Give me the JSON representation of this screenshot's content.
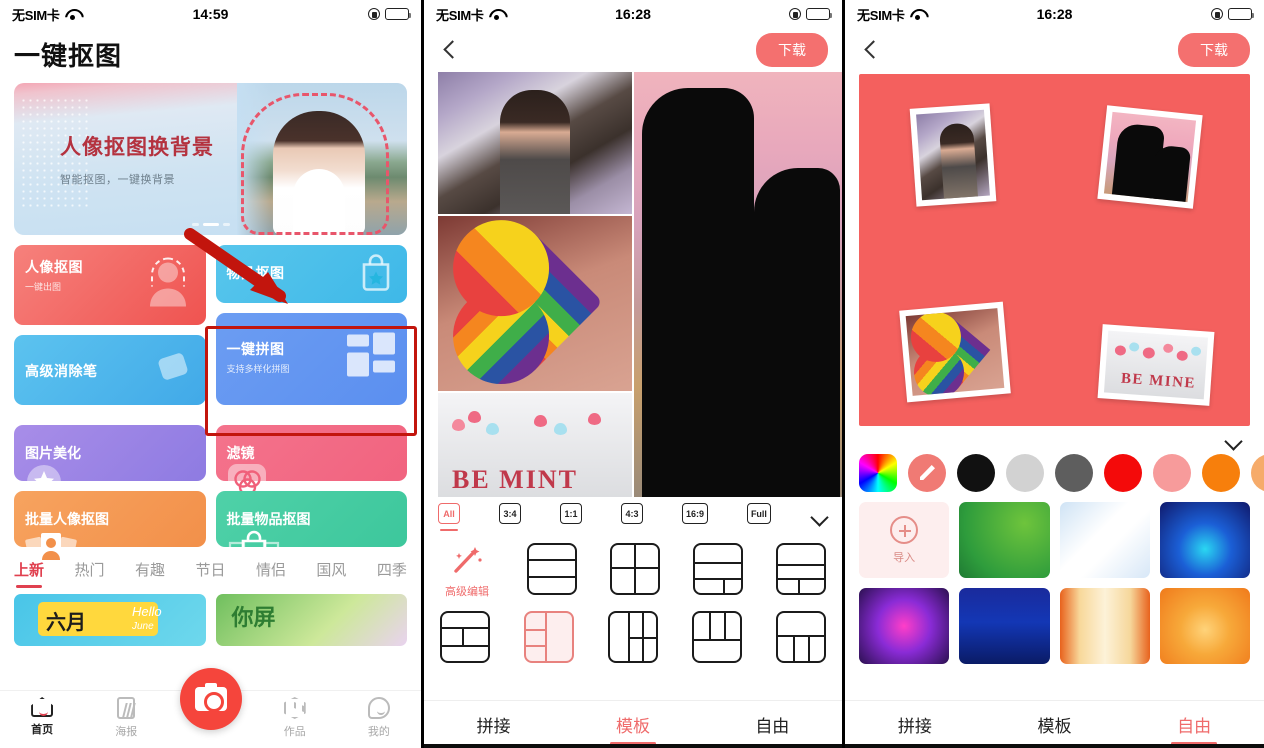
{
  "panel1": {
    "status": {
      "carrier": "无SIM卡",
      "time": "14:59",
      "wifi_icon": "wifi-icon",
      "lock_icon": "rotation-lock-icon",
      "battery_icon": "battery-icon"
    },
    "page_title": "一键抠图",
    "banner": {
      "title": "人像抠图换背景",
      "subtitle": "智能抠图，一键换背景"
    },
    "cards": [
      {
        "title": "人像抠图",
        "sub": "一键出图",
        "icon": "person-cutout-icon"
      },
      {
        "title": "物品抠图",
        "sub": "",
        "icon": "shopping-bag-star-icon"
      },
      {
        "title": "高级消除笔",
        "sub": "",
        "icon": "eraser-pen-icon"
      },
      {
        "title": "一键拼图",
        "sub": "支持多样化拼图",
        "icon": "collage-layout-icon"
      },
      {
        "title": "图片美化",
        "sub": "",
        "icon": "magic-star-icon"
      },
      {
        "title": "滤镜",
        "sub": "",
        "icon": "filter-circles-icon"
      },
      {
        "title": "批量人像抠图",
        "sub": "",
        "icon": "batch-person-icon"
      },
      {
        "title": "批量物品抠图",
        "sub": "",
        "icon": "batch-bag-icon"
      }
    ],
    "category_tabs": [
      {
        "label": "上新",
        "selected": true
      },
      {
        "label": "热门",
        "selected": false
      },
      {
        "label": "有趣",
        "selected": false
      },
      {
        "label": "节日",
        "selected": false
      },
      {
        "label": "情侣",
        "selected": false
      },
      {
        "label": "国风",
        "selected": false
      },
      {
        "label": "四季",
        "selected": false
      }
    ],
    "posters": [
      {
        "main": "六月",
        "hello": "Hello",
        "june": "June"
      },
      {
        "main": "你屏"
      }
    ],
    "camera_button_icon": "camera-icon",
    "tabbar": [
      {
        "label": "首页",
        "icon": "home-icon",
        "selected": true
      },
      {
        "label": "海报",
        "icon": "poster-icon",
        "selected": false
      },
      {
        "label": "作品",
        "icon": "works-icon",
        "selected": false
      },
      {
        "label": "我的",
        "icon": "profile-icon",
        "selected": false
      }
    ]
  },
  "panel2": {
    "status": {
      "carrier": "无SIM卡",
      "time": "16:28"
    },
    "nav": {
      "back_icon": "back-chevron-icon",
      "download_label": "下载"
    },
    "ratio_tabs": [
      {
        "label": "All",
        "selected": true
      },
      {
        "label": "3:4",
        "selected": false
      },
      {
        "label": "1:1",
        "selected": false
      },
      {
        "label": "4:3",
        "selected": false
      },
      {
        "label": "16:9",
        "selected": false
      },
      {
        "label": "Full",
        "selected": false
      }
    ],
    "expand_icon": "chevron-down-icon",
    "advanced_edit": {
      "label": "高级编辑",
      "icon": "magic-wand-icon"
    },
    "layout_selected_index": 6,
    "bottom_tabs": [
      {
        "label": "拼接",
        "selected": false
      },
      {
        "label": "模板",
        "selected": true
      },
      {
        "label": "自由",
        "selected": false
      }
    ],
    "bemine_text": "BE MINT"
  },
  "panel3": {
    "status": {
      "carrier": "无SIM卡",
      "time": "16:28"
    },
    "nav": {
      "back_icon": "back-chevron-icon",
      "download_label": "下载"
    },
    "canvas_background_color": "#f4605e",
    "bemine_text": "BE MINE",
    "collapse_icon": "chevron-down-icon",
    "color_swatches": [
      {
        "name": "rainbow-picker",
        "color": "rainbow"
      },
      {
        "name": "eyedropper",
        "color": "#f07a74"
      },
      {
        "name": "black",
        "color": "#111111"
      },
      {
        "name": "light-gray",
        "color": "#d2d2d2"
      },
      {
        "name": "dark-gray",
        "color": "#5e5e5e"
      },
      {
        "name": "red",
        "color": "#f40a0a"
      },
      {
        "name": "pink",
        "color": "#f79b9b"
      },
      {
        "name": "orange",
        "color": "#f77f0c"
      },
      {
        "name": "light-orange",
        "color": "#f6ab6a"
      }
    ],
    "import_tile": {
      "label": "导入",
      "icon": "plus-icon"
    },
    "backgrounds": [
      "green-gradient",
      "white-light-burst",
      "blue-tunnel",
      "purple-cube",
      "blue-city",
      "gold-light",
      "orange-hexagon"
    ],
    "bottom_tabs": [
      {
        "label": "拼接",
        "selected": false
      },
      {
        "label": "模板",
        "selected": false
      },
      {
        "label": "自由",
        "selected": true
      }
    ]
  }
}
